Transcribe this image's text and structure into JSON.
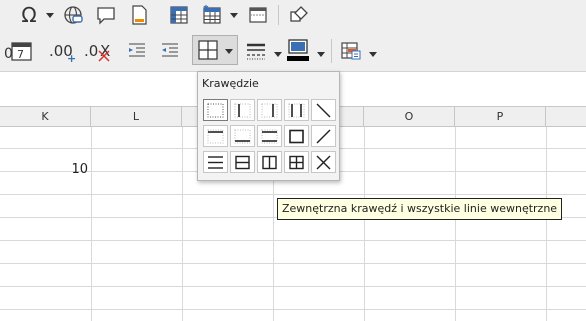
{
  "toolbar_top": {
    "buttons": [
      "special-character",
      "hyperlink",
      "comment",
      "header-footer",
      "pivot-table",
      "insert-table",
      "print-ranges",
      "shapes"
    ]
  },
  "toolbar_bottom": {
    "items": [
      "date-format",
      "add-decimal",
      "delete-decimal",
      "increase-indent",
      "decrease-indent",
      "borders",
      "border-style",
      "border-color",
      "conditional-format"
    ]
  },
  "columns": [
    "K",
    "L",
    "O",
    "P"
  ],
  "cell_value": "10",
  "borders_popup": {
    "title": "Krawędzie",
    "presets": [
      "no-borders",
      "left-border",
      "right-border",
      "left-right-borders",
      "diagonal-down",
      "top-border",
      "bottom-border",
      "top-bottom-borders",
      "outer-border",
      "diagonal-up",
      "horizontal-inner",
      "box-horizontal-inner",
      "box-vertical-inner",
      "box-all-inner",
      "diagonal-cross"
    ]
  },
  "tooltip": "Zewnętrzna krawędź i wszystkie linie wewnętrzne",
  "colors": {
    "toolbar_bg": "#efefef",
    "tooltip_bg": "#ffffe1",
    "border_color_bar": "#000000"
  }
}
